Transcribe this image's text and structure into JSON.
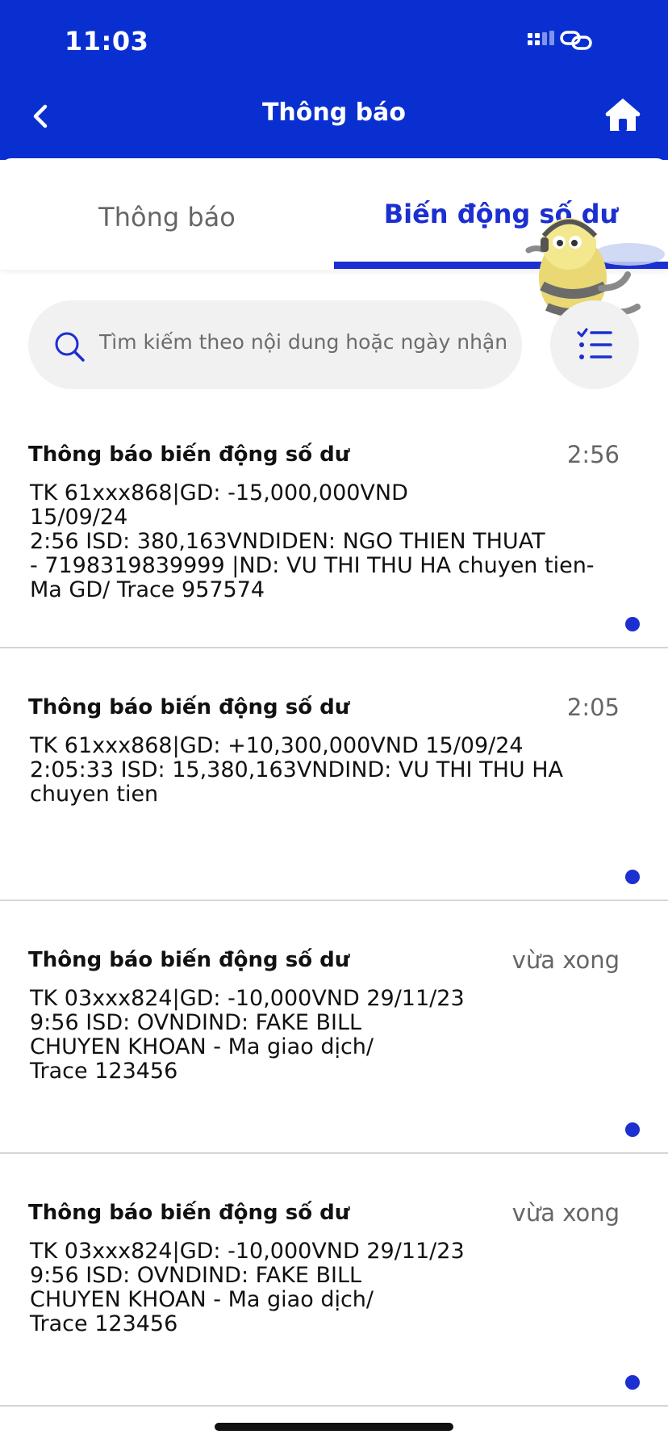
{
  "status_bar": {
    "time": "11:03"
  },
  "header": {
    "title": "Thông báo",
    "background_color": "#0a2fd1",
    "back_icon": "chevron-left-icon",
    "home_icon": "home-icon"
  },
  "tabs": [
    {
      "label": "Thông báo",
      "active": false
    },
    {
      "label": "Biến động số dư",
      "active": true
    }
  ],
  "accent_color": "#1c2fd0",
  "search": {
    "placeholder": "Tìm kiếm theo nội dung hoặc ngày nhận",
    "icon": "search-icon"
  },
  "filter": {
    "icon": "checklist-icon"
  },
  "notifications": [
    {
      "title": "Thông báo biến động số dư",
      "time": "2:56",
      "body": "TK 61xxx868|GD: -15,000,000VND\n15/09/24\n2:56 ISD: 380,163VNDIDEN: NGO THIEN THUAT\n- 7198319839999 |ND: VU THI THU HA chuyen tien-\nMa GD/ Trace 957574",
      "unread": true
    },
    {
      "title": "Thông báo biến động số dư",
      "time": "2:05",
      "body": "TK 61xxx868|GD: +10,300,000VND 15/09/24\n2:05:33 ISD: 15,380,163VNDIND: VU THI THU HA\nchuyen tien",
      "unread": true
    },
    {
      "title": "Thông báo biến động số dư",
      "time": "vừa xong",
      "body": "TK 03xxx824|GD: -10,000VND 29/11/23\n9:56 ISD: OVNDIND: FAKE BILL\nCHUYEN KHOAN - Ma giao dịch/\nTrace 123456",
      "unread": true
    },
    {
      "title": "Thông báo biến động số dư",
      "time": "vừa xong",
      "body": "TK 03xxx824|GD: -10,000VND 29/11/23\n9:56 ISD: OVNDIND: FAKE BILL\nCHUYEN KHOAN - Ma giao dịch/\nTrace 123456",
      "unread": true
    }
  ]
}
